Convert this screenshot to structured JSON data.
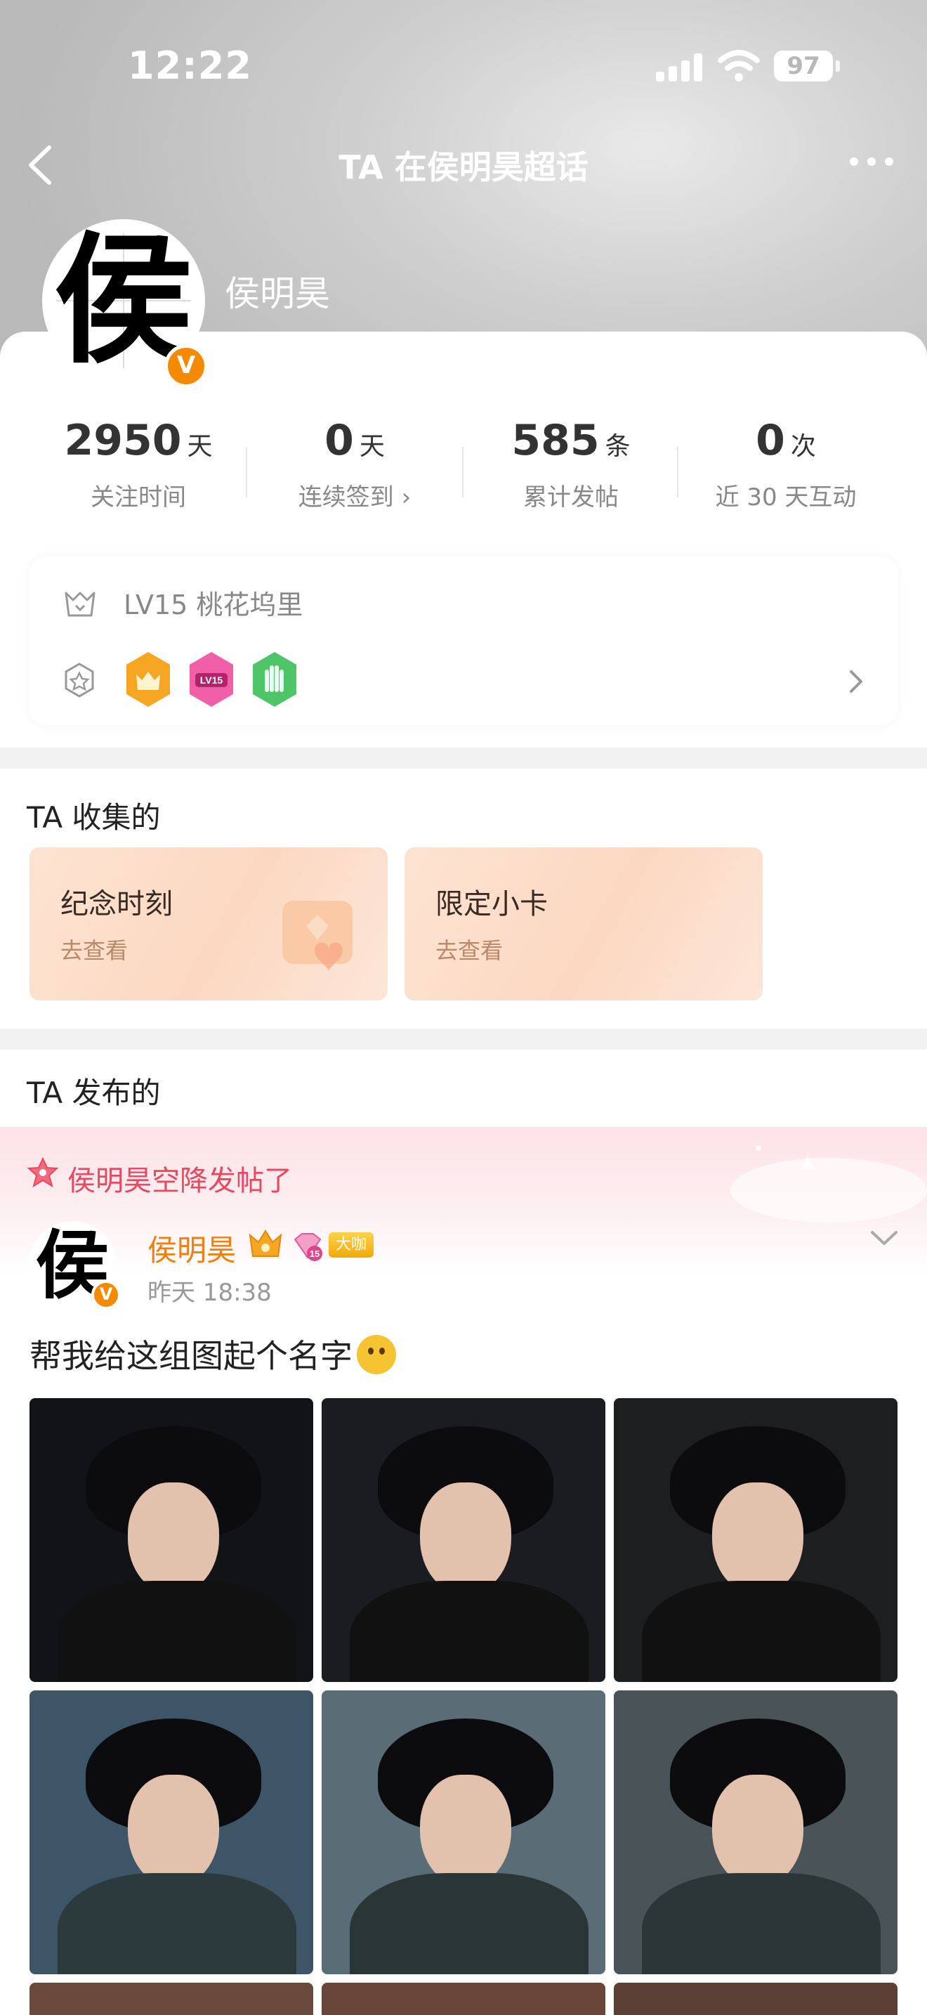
{
  "status_bar": {
    "time": "12:22",
    "battery": "97"
  },
  "nav": {
    "title": "TA 在侯明昊超话"
  },
  "profile": {
    "avatar_char": "侯",
    "verified_mark": "V",
    "name": "侯明昊"
  },
  "stats": [
    {
      "value": "2950",
      "unit": "天",
      "label": "关注时间"
    },
    {
      "value": "0",
      "unit": "天",
      "label": "连续签到 ›"
    },
    {
      "value": "585",
      "unit": "条",
      "label": "累计发帖"
    },
    {
      "value": "0",
      "unit": "次",
      "label": "近 30 天互动"
    }
  ],
  "level": {
    "text": "LV15 桃花坞里",
    "medal_badge": "LV15"
  },
  "collections": {
    "title": "TA 收集的",
    "cards": [
      {
        "title": "纪念时刻",
        "sub": "去查看"
      },
      {
        "title": "限定小卡",
        "sub": "去查看"
      }
    ]
  },
  "posts": {
    "title": "TA 发布的",
    "banner": "侯明昊空降发帖了",
    "author": "侯明昊",
    "author_avatar_char": "侯",
    "badge_number": "15",
    "tag": "大咖",
    "time": "昨天 18:38",
    "text": "帮我给这组图起个名字"
  },
  "colors": {
    "accent_orange": "#f07f12",
    "banner_red": "#e8495f",
    "verified": "#f58a00"
  }
}
